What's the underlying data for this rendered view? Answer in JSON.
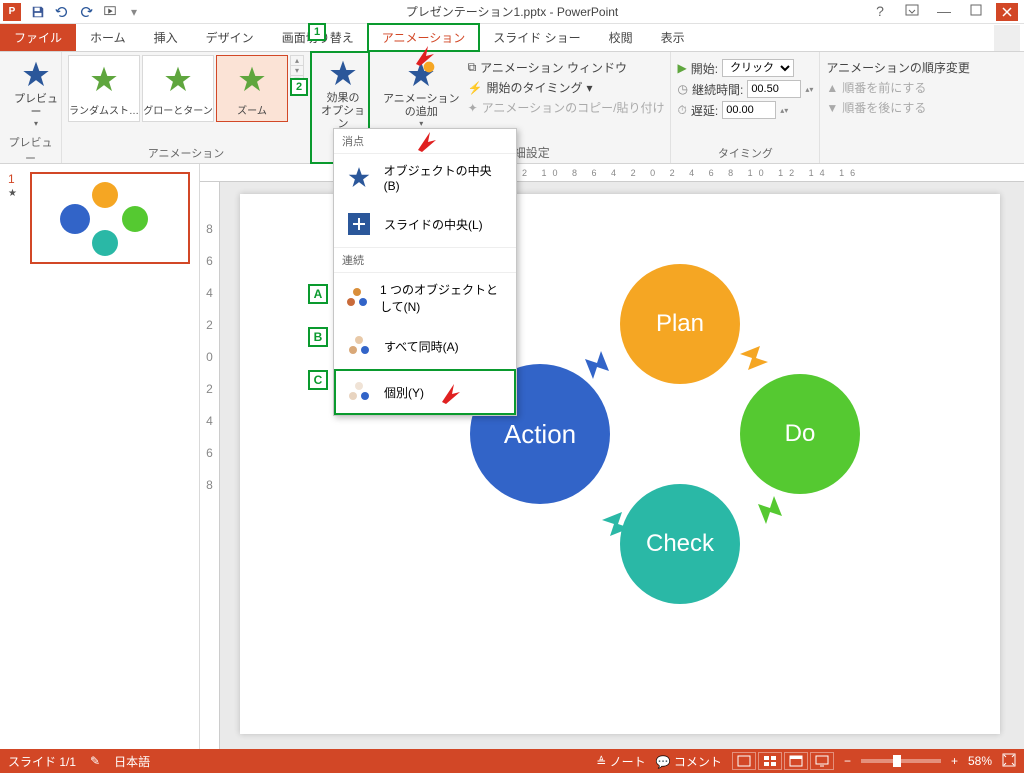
{
  "app": {
    "title": "プレゼンテーション1.pptx - PowerPoint"
  },
  "qat": {
    "save": "保存",
    "undo": "元に戻す",
    "redo": "やり直し",
    "start": "先頭から"
  },
  "tabs": {
    "file": "ファイル",
    "home": "ホーム",
    "insert": "挿入",
    "design": "デザイン",
    "transitions": "画面切り替え",
    "animations": "アニメーション",
    "slideshow": "スライド ショー",
    "review": "校閲",
    "view": "表示"
  },
  "ribbon": {
    "preview": "プレビュー",
    "preview_group": "プレビュー",
    "animation_group": "アニメーション",
    "gallery": {
      "random": "ランダムスト…",
      "glow": "グローとターン",
      "zoom": "ズーム"
    },
    "effect_options": "効果の\nオプション",
    "add_animation": "アニメーション\nの追加",
    "pane": "アニメーション ウィンドウ",
    "trigger": "開始のタイミング",
    "painter": "アニメーションのコピー/貼り付け",
    "advanced_group_suffix": "の詳細設定",
    "timing": {
      "start_label": "開始:",
      "start_value": "クリック時",
      "duration_label": "継続時間:",
      "duration_value": "00.50",
      "delay_label": "遅延:",
      "delay_value": "00.00",
      "group": "タイミング"
    },
    "reorder": {
      "title": "アニメーションの順序変更",
      "earlier": "順番を前にする",
      "later": "順番を後にする"
    }
  },
  "dropdown": {
    "section1": "消点",
    "obj_center": "オブジェクトの中央(B)",
    "slide_center": "スライドの中央(L)",
    "section2": "連続",
    "as_one": "1 つのオブジェクトとして(N)",
    "all_at_once": "すべて同時(A)",
    "one_by_one": "個別(Y)"
  },
  "callouts": {
    "n1": "1",
    "n2": "2",
    "a": "A",
    "b": "B",
    "c": "C"
  },
  "slide": {
    "plan": "Plan",
    "do": "Do",
    "check": "Check",
    "action": "Action"
  },
  "thumb_num": "1",
  "status": {
    "slide": "スライド 1/1",
    "lang": "日本語",
    "notes": "ノート",
    "comments": "コメント",
    "zoom": "58%"
  }
}
